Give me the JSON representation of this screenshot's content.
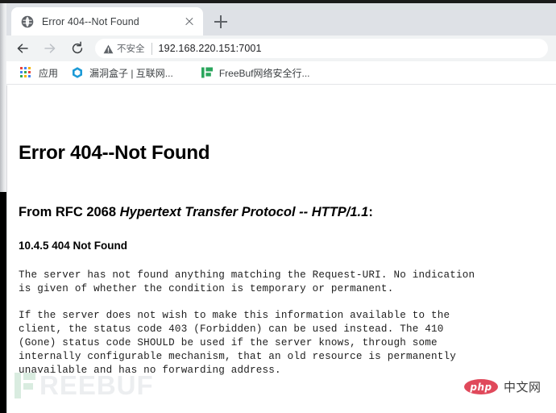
{
  "browser": {
    "tab": {
      "title": "Error 404--Not Found",
      "favicon": "globe-icon",
      "close_label": "×"
    },
    "new_tab_label": "+",
    "toolbar": {
      "back_label": "Back",
      "forward_label": "Forward",
      "reload_label": "Reload",
      "security_text": "不安全",
      "security_icon": "warning-triangle-icon",
      "url": "192.168.220.151:7001"
    },
    "bookmarks": [
      {
        "label": "应用",
        "icon": "apps-grid-icon"
      },
      {
        "label": "漏洞盒子 | 互联网...",
        "icon": "vulbox-hexagon-icon"
      },
      {
        "label": "FreeBuf网络安全行...",
        "icon": "freebuf-logo-icon"
      }
    ]
  },
  "page": {
    "h1": "Error 404--Not Found",
    "h2_prefix": "From RFC 2068 ",
    "h2_italic": "Hypertext Transfer Protocol -- HTTP/1.1",
    "h2_suffix": ":",
    "h3": "10.4.5 404 Not Found",
    "paragraph_1": "The server has not found anything matching the Request-URI. No indication\nis given of whether the condition is temporary or permanent.",
    "paragraph_2": "If the server does not wish to make this information available to the\nclient, the status code 403 (Forbidden) can be used instead. The 410\n(Gone) status code SHOULD be used if the server knows, through some\ninternally configurable mechanism, that an old resource is permanently\nunavailable and has no forwarding address."
  },
  "watermarks": {
    "freebuf": "REEBUF",
    "php_pill": "php",
    "php_cn": "中文网"
  },
  "colors": {
    "tabstrip_bg": "#dee1e6",
    "toolbar_bg": "#f1f3f4",
    "tab_bg": "#ffffff",
    "text_primary": "#202124",
    "text_secondary": "#5f6368",
    "freebuf_green": "#2aa65c",
    "php_red": "#e0495b"
  }
}
